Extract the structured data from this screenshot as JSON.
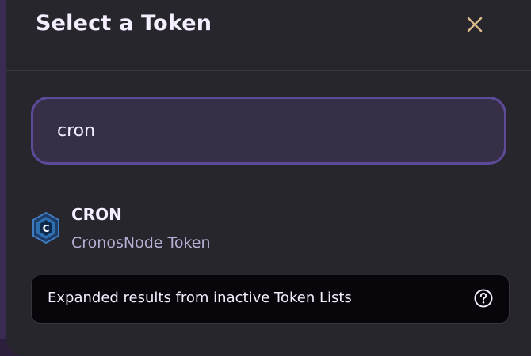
{
  "modal": {
    "title": "Select a Token"
  },
  "search": {
    "value": "cron",
    "placeholder": ""
  },
  "results": [
    {
      "symbol": "CRON",
      "name": "CronosNode Token",
      "icon": "cronosnode-token-logo"
    }
  ],
  "expanded": {
    "label": "Expanded results from inactive Token Lists",
    "icon": "help-circle-icon"
  },
  "colors": {
    "modal_background": "#27262c",
    "search_border": "#5d4a99",
    "close_icon": "#d9b78a",
    "text_primary": "#f4eeff",
    "text_secondary": "#b8add2"
  }
}
